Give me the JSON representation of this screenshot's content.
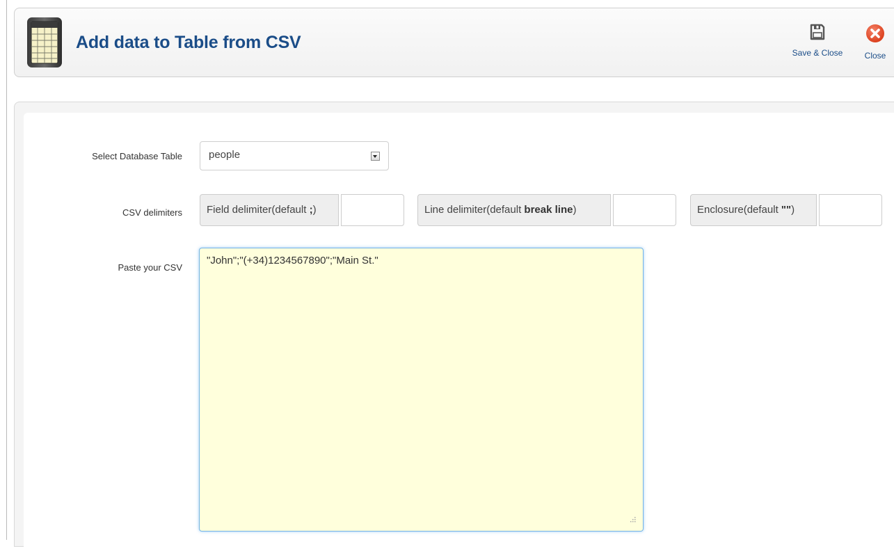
{
  "header": {
    "title": "Add data to Table from CSV",
    "icon": "table-grid-icon",
    "buttons": {
      "save_close": {
        "label": "Save & Close",
        "icon": "floppy-disk-icon"
      },
      "close": {
        "label": "Close",
        "icon": "close-circle-icon",
        "color": "#e04a24"
      }
    }
  },
  "form": {
    "select_table": {
      "label": "Select Database Table",
      "value": "people"
    },
    "delimiters": {
      "label": "CSV delimiters",
      "field": {
        "prefix": "Field delimiter(default ",
        "bold": ";",
        "suffix": ")",
        "value": ""
      },
      "line": {
        "prefix": "Line delimiter(default ",
        "bold": "break line",
        "suffix": ")",
        "value": ""
      },
      "enclosure": {
        "prefix": "Enclosure(default ",
        "bold": "\"\"",
        "suffix": ")",
        "value": ""
      }
    },
    "csv": {
      "label": "Paste your CSV",
      "value": "\"John\";\"(+34)1234567890\";\"Main St.\""
    }
  },
  "colors": {
    "title": "#1b4d88",
    "textarea_bg": "#ffffdc",
    "textarea_focus": "#74b3e8"
  }
}
